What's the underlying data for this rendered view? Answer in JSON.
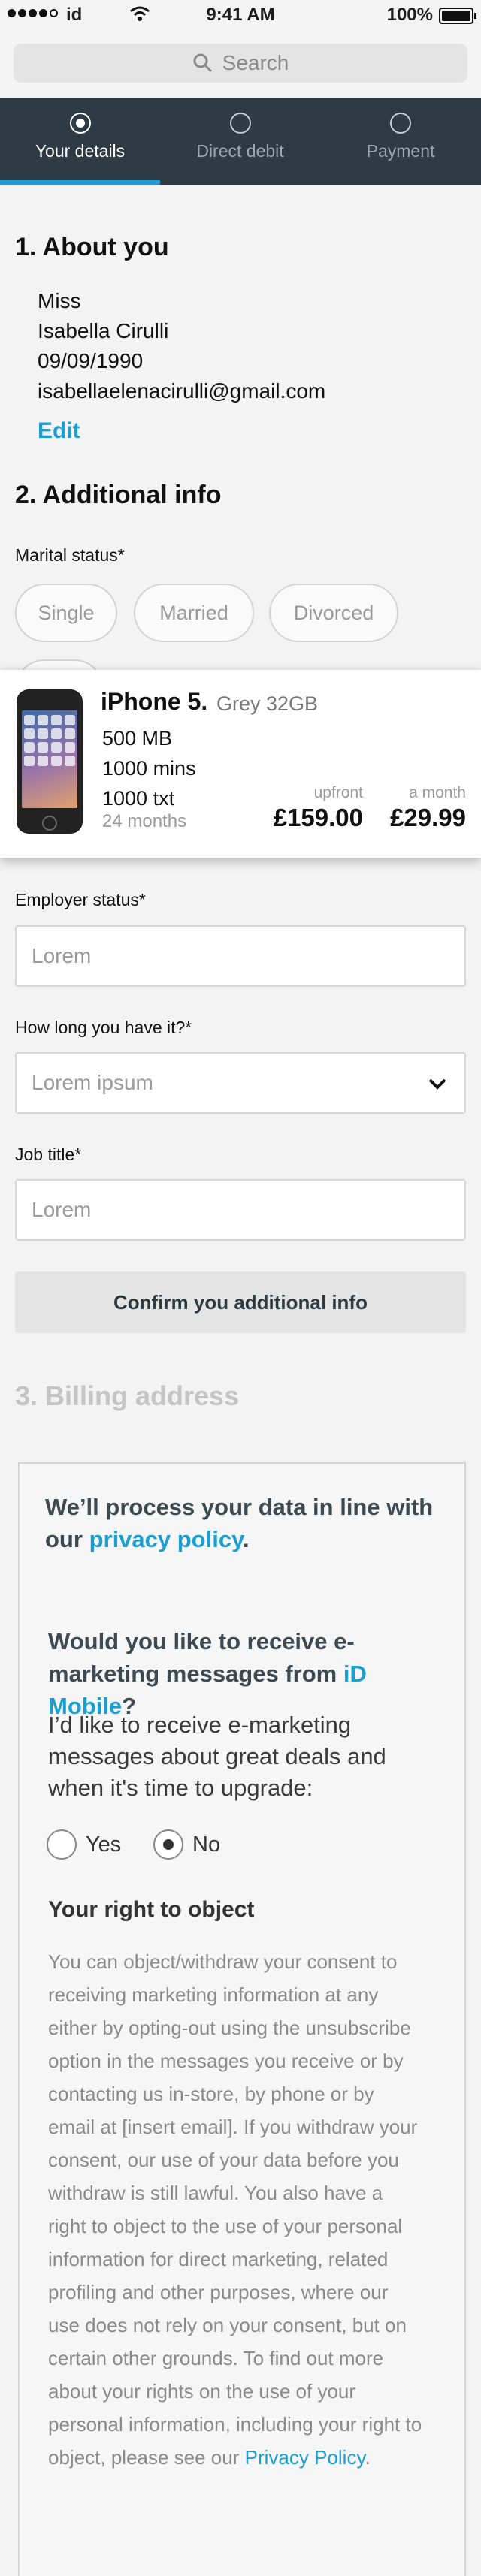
{
  "status_bar": {
    "carrier": "id",
    "time": "9:41 AM",
    "battery": "100%"
  },
  "search": {
    "placeholder": "Search"
  },
  "steps": [
    {
      "label": "Your details",
      "active": true
    },
    {
      "label": "Direct debit",
      "active": false
    },
    {
      "label": "Payment",
      "active": false
    }
  ],
  "about": {
    "heading": "1. About you",
    "title": "Miss",
    "name": "Isabella Cirulli",
    "dob": "09/09/1990",
    "email": "isabellaelenacirulli@gmail.com",
    "edit_label": "Edit"
  },
  "additional": {
    "heading": "2. Additional info",
    "marital_label": "Marital status*",
    "marital_options": [
      "Single",
      "Married",
      "Divorced"
    ],
    "employer_label": "Employer status*",
    "employer_placeholder": "Lorem",
    "how_long_label": "How long you have it?*",
    "how_long_value": "Lorem ipsum",
    "job_title_label": "Job title*",
    "job_title_placeholder": "Lorem",
    "confirm_label": "Confirm you additional info"
  },
  "product": {
    "name": "iPhone 5.",
    "variant": "Grey 32GB",
    "data": "500 MB",
    "minutes": "1000 mins",
    "texts": "1000 txt",
    "term": "24 months",
    "upfront_label": "upfront",
    "upfront_price": "£159.00",
    "monthly_label": "a month",
    "monthly_price": "£29.99"
  },
  "billing": {
    "heading": "3. Billing address",
    "process_prefix": "We’ll process your data in line with our",
    "privacy_link": "privacy policy",
    "period": ".",
    "question_prefix": "Would you like to receive e-marketing messages from",
    "question_brand": "iD Mobile",
    "question_suffix": "?",
    "prompt": "I’d like to receive e-marketing messages about great deals and when it's time to upgrade:",
    "yes_label": "Yes",
    "no_label": "No",
    "right_heading": "Your right to object",
    "right_body": "You can object/withdraw your consent to receiving marketing information at any either by opting-out using the unsubscribe option in the messages you receive or by contacting us in-store, by phone or by email at [insert email]. If you withdraw your consent, our use of your data before you withdraw is still lawful. You also have a right to object to the use of your personal information for direct marketing, related profiling and other purposes, where our use does not rely on your consent, but on certain other grounds. To find out more about your rights on the use of your personal information, including your right to object, please see our",
    "policy_link": "Privacy Policy",
    "policy_period": "."
  }
}
